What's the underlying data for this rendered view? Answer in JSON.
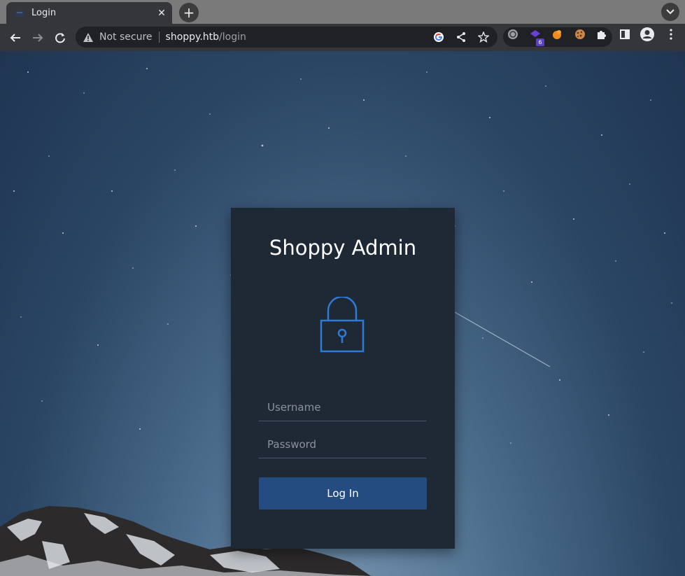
{
  "browser": {
    "tab": {
      "title": "Login",
      "favicon": "page-favicon",
      "close_icon": "close-icon"
    },
    "new_tab_icon": "plus-icon",
    "tab_search_icon": "chevron-down-icon",
    "nav": {
      "back_icon": "arrow-back-icon",
      "forward_icon": "arrow-forward-icon",
      "reload_icon": "reload-icon"
    },
    "omnibox": {
      "security_label": "Not secure",
      "security_icon": "warning-icon",
      "url_host": "shoppy.htb",
      "url_path": "/login",
      "actions": [
        "google-icon",
        "share-icon",
        "star-icon"
      ]
    },
    "extensions": [
      {
        "name": "extension-1-icon"
      },
      {
        "name": "extension-2-icon",
        "badge": "6"
      },
      {
        "name": "extension-3-icon"
      },
      {
        "name": "cookie-icon"
      },
      {
        "name": "puzzle-icon"
      }
    ],
    "side_panel_icon": "side-panel-icon",
    "profile_icon": "profile-icon",
    "menu_icon": "more-vert-icon"
  },
  "login": {
    "title": "Shoppy Admin",
    "lock_icon": "lock-icon",
    "username_placeholder": "Username",
    "password_placeholder": "Password",
    "submit_label": "Log In",
    "accent_color": "#2e7ad6",
    "button_color": "#244c80",
    "card_color": "#1f2935"
  }
}
